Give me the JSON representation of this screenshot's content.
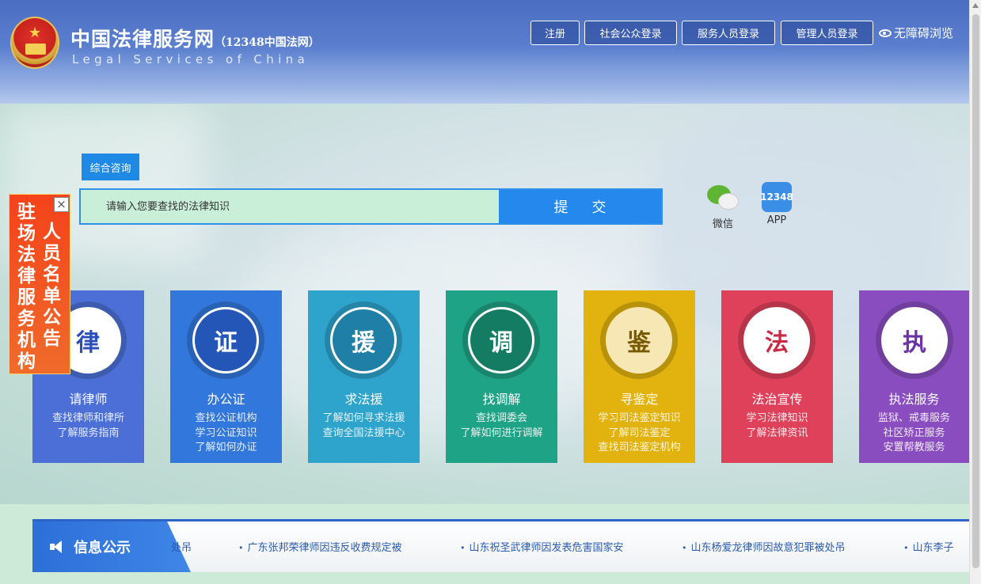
{
  "header": {
    "title": "中国法律服务网",
    "title_sub": "（12348中国法网）",
    "subtitle_en": "Legal Services of China",
    "buttons": {
      "register": "注册",
      "public_login": "社会公众登录",
      "service_login": "服务人员登录",
      "admin_login": "管理人员登录"
    },
    "accessibility": "无障碍浏览"
  },
  "search": {
    "tab_label": "综合咨询",
    "placeholder": "请输入您要查找的法律知识",
    "submit_label": "提交"
  },
  "qr": {
    "wechat_label": "微信",
    "app_badge": "12348",
    "app_label": "APP"
  },
  "banner": {
    "col1": "驻场法律服务机构",
    "col2": "人员名单公告",
    "close": "×"
  },
  "cards": [
    {
      "title": "请律师",
      "lines": [
        "查找律师和律所",
        "了解服务指南"
      ],
      "icon": "lawyers-association-emblem",
      "color": "#4b6fd6"
    },
    {
      "title": "办公证",
      "lines": [
        "查找公证机构",
        "学习公证知识",
        "了解如何办证"
      ],
      "icon": "notary-emblem",
      "color": "#3277dc"
    },
    {
      "title": "求法援",
      "lines": [
        "了解如何寻求法援",
        "查询全国法援中心"
      ],
      "icon": "legal-aid-emblem",
      "color": "#2ea3cc"
    },
    {
      "title": "找调解",
      "lines": [
        "查找调委会",
        "了解如何进行调解"
      ],
      "icon": "mediation-emblem",
      "color": "#1fa386"
    },
    {
      "title": "寻鉴定",
      "lines": [
        "学习司法鉴定知识",
        "了解司法鉴定",
        "查找司法鉴定机构"
      ],
      "icon": "forensic-appraisal-emblem",
      "color": "#e2b20e"
    },
    {
      "title": "法治宣传",
      "lines": [
        "学习法律知识",
        "了解法律资讯"
      ],
      "icon": "rule-of-law-emblem",
      "color": "#e0415a"
    },
    {
      "title": "执法服务",
      "lines": [
        "监狱、戒毒服务",
        "社区矫正服务",
        "安置帮教服务"
      ],
      "icon": "law-enforcement-emblem",
      "color": "#8a4dc0"
    }
  ],
  "info": {
    "title": "信息公示",
    "items": [
      "处吊",
      "广东张邦荣律师因违反收费规定被",
      "山东祝圣武律师因发表危害国家安",
      "山东杨爱龙律师因故意犯罪被处吊",
      "山东李子"
    ]
  }
}
